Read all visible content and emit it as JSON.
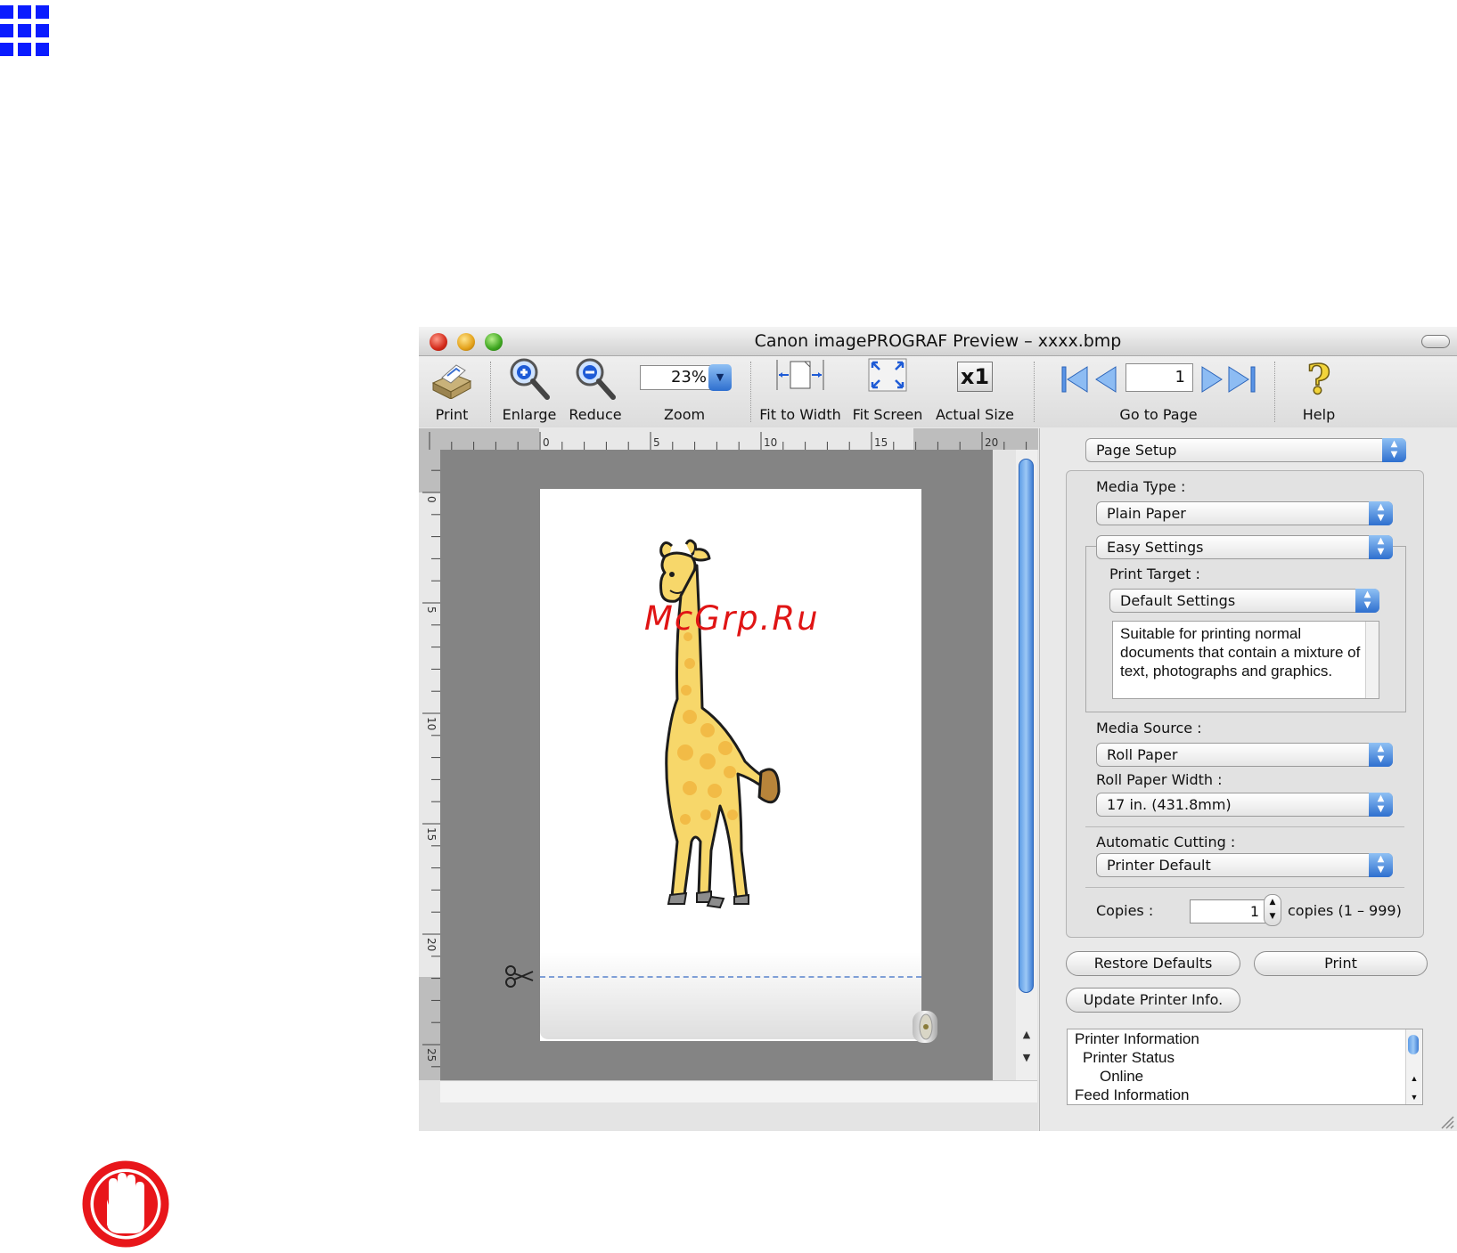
{
  "window": {
    "title": "Canon imagePROGRAF Preview – xxxx.bmp"
  },
  "toolbar": {
    "print_label": "Print",
    "enlarge_label": "Enlarge",
    "reduce_label": "Reduce",
    "zoom_label": "Zoom",
    "zoom_value": "23%",
    "fit_width_label": "Fit to Width",
    "fit_screen_label": "Fit Screen",
    "actual_size_label": "Actual Size",
    "actual_size_glyph": "x1",
    "go_to_page_label": "Go to Page",
    "page_value": "1",
    "help_label": "Help"
  },
  "rulers": {
    "top_ticks": [
      "0",
      "5",
      "10",
      "15",
      "20"
    ],
    "left_ticks": [
      "0",
      "5",
      "10",
      "15",
      "20",
      "25"
    ]
  },
  "watermark": "McGrp.Ru",
  "panel": {
    "page_setup": "Page Setup",
    "media_type_label": "Media Type :",
    "media_type_value": "Plain Paper",
    "easy_settings": "Easy Settings",
    "print_target_label": "Print Target :",
    "print_target_value": "Default Settings",
    "description": "Suitable for printing normal documents that contain a mixture of text, photographs and graphics.",
    "media_source_label": "Media Source :",
    "media_source_value": "Roll Paper",
    "roll_width_label": "Roll Paper Width :",
    "roll_width_value": "17 in. (431.8mm)",
    "auto_cut_label": "Automatic Cutting :",
    "auto_cut_value": "Printer Default",
    "copies_label": "Copies :",
    "copies_value": "1",
    "copies_range": "copies (1 – 999)",
    "restore_defaults": "Restore Defaults",
    "print_button": "Print",
    "update_info": "Update Printer Info."
  },
  "printer_info": {
    "lines": [
      "Printer Information",
      "Printer Status",
      "Online",
      "Feed Information"
    ]
  },
  "colors": {
    "grid_icon": "#0a1cff",
    "stop_icon": "#e8161a",
    "aqua_blue": "#2e6fcf",
    "watermark": "#e01515"
  }
}
